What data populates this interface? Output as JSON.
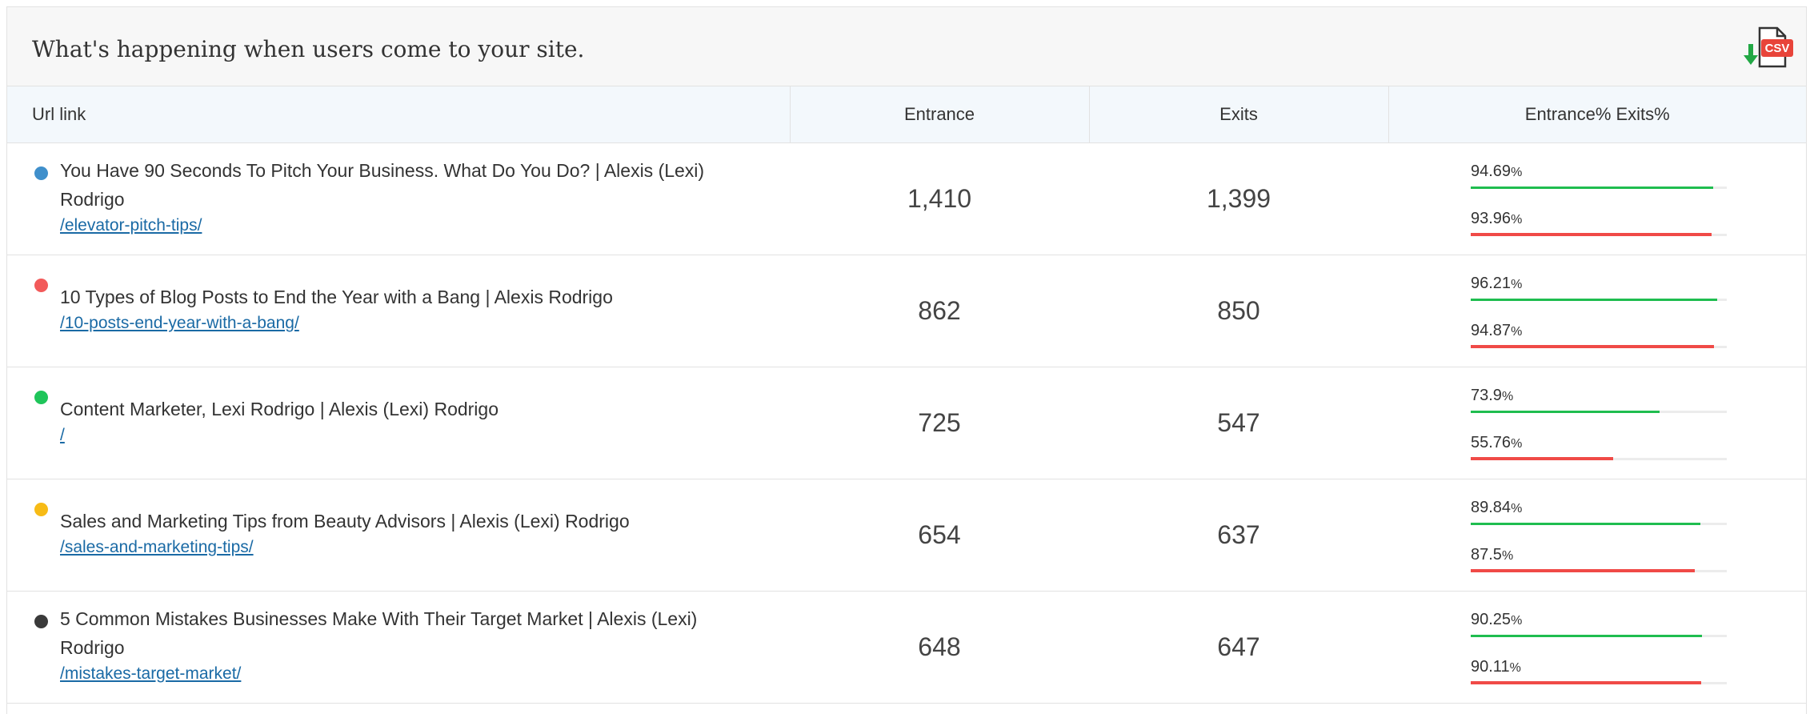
{
  "header": {
    "title": "What's happening when users come to your site."
  },
  "csv": {
    "label": "CSV",
    "icon": "csv-download-icon"
  },
  "colors": {
    "green": "#1fbd4f",
    "red": "#f04a47",
    "link": "#1a6aa5"
  },
  "columns": {
    "url": "Url link",
    "entrance": "Entrance",
    "exits": "Exits",
    "pct": "Entrance% Exits%"
  },
  "rows": [
    {
      "dot_color": "#3f8fcb",
      "title": "You Have 90 Seconds To Pitch Your Business. What Do You Do? | Alexis (Lexi) Rodrigo",
      "link": "/elevator-pitch-tips/",
      "entrance": "1,410",
      "exits": "1,399",
      "entrance_pct": "94.69",
      "exits_pct": "93.96",
      "entrance_pct_value": 94.69,
      "exits_pct_value": 93.96
    },
    {
      "dot_color": "#f25a5a",
      "title": "10 Types of Blog Posts to End the Year with a Bang | Alexis Rodrigo",
      "link": "/10-posts-end-year-with-a-bang/",
      "entrance": "862",
      "exits": "850",
      "entrance_pct": "96.21",
      "exits_pct": "94.87",
      "entrance_pct_value": 96.21,
      "exits_pct_value": 94.87
    },
    {
      "dot_color": "#1fc55a",
      "title": "Content Marketer, Lexi Rodrigo | Alexis (Lexi) Rodrigo",
      "link": "/",
      "entrance": "725",
      "exits": "547",
      "entrance_pct": "73.9",
      "exits_pct": "55.76",
      "entrance_pct_value": 73.9,
      "exits_pct_value": 55.76
    },
    {
      "dot_color": "#f7bb16",
      "title": "Sales and Marketing Tips from Beauty Advisors | Alexis (Lexi) Rodrigo",
      "link": "/sales-and-marketing-tips/",
      "entrance": "654",
      "exits": "637",
      "entrance_pct": "89.84",
      "exits_pct": "87.5",
      "entrance_pct_value": 89.84,
      "exits_pct_value": 87.5
    },
    {
      "dot_color": "#3a3a3a",
      "title": "5 Common Mistakes Businesses Make With Their Target Market | Alexis (Lexi) Rodrigo",
      "link": "/mistakes-target-market/",
      "entrance": "648",
      "exits": "647",
      "entrance_pct": "90.25",
      "exits_pct": "90.11",
      "entrance_pct_value": 90.25,
      "exits_pct_value": 90.11
    }
  ],
  "pct_symbol": "%"
}
